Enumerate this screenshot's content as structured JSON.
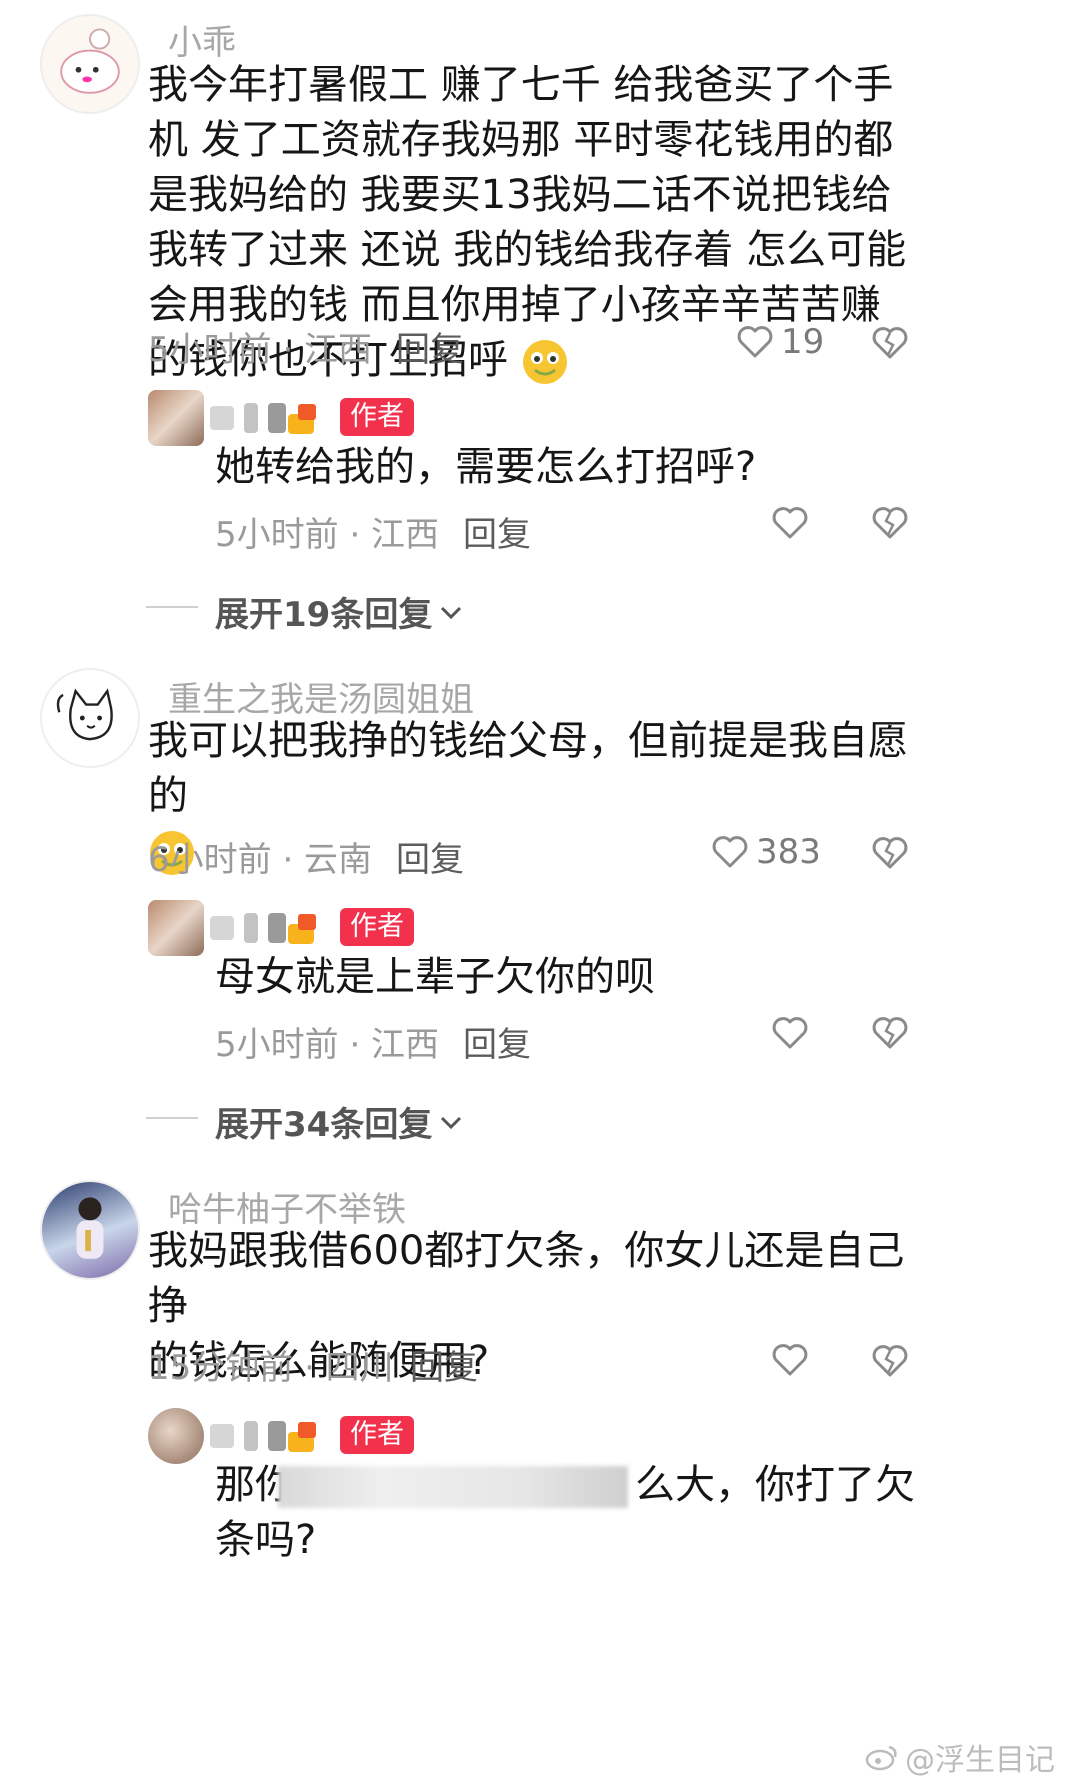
{
  "comments": [
    {
      "user": "小乖",
      "text": "我今年打暑假工 赚了七千 给我爸买了个手机 发了工资就存我妈那 平时零花钱用的都是我妈给的 我要买13我妈二话不说把钱给我转了过来 还说 我的钱给我存着 怎么可能会用我的钱 而且你用掉了小孩辛辛苦苦赚的钱你也不打生招呼",
      "time_loc": "5小时前 · 江西",
      "reply_label": "回复",
      "likes": "19",
      "author_reply": {
        "badge": "作者",
        "text": "她转给我的，需要怎么打招呼?",
        "time_loc": "5小时前 · 江西",
        "reply_label": "回复"
      },
      "expand_label": "展开19条回复"
    },
    {
      "user": "重生之我是汤圆姐姐",
      "text": "我可以把我挣的钱给父母，但前提是我自愿的",
      "time_loc": "6小时前 · 云南",
      "reply_label": "回复",
      "likes": "383",
      "author_reply": {
        "badge": "作者",
        "text": "母女就是上辈子欠你的呗",
        "time_loc": "5小时前 · 江西",
        "reply_label": "回复"
      },
      "expand_label": "展开34条回复"
    },
    {
      "user": "哈牛柚子不举铁",
      "text_line1": "我妈跟我借600都打欠条，你女儿还是自己挣",
      "text_line2": "的钱怎么能随便用?",
      "time_loc": "15分钟前 · 四川",
      "reply_label": "回复",
      "author_reply": {
        "badge": "作者",
        "text_start": "那你",
        "text_end": "么大，你打了欠",
        "text_line2": "条吗?"
      }
    }
  ],
  "watermark": "@浮生目记",
  "colors": {
    "author_badge": "#f2314d",
    "emoji": "#f7c531"
  }
}
